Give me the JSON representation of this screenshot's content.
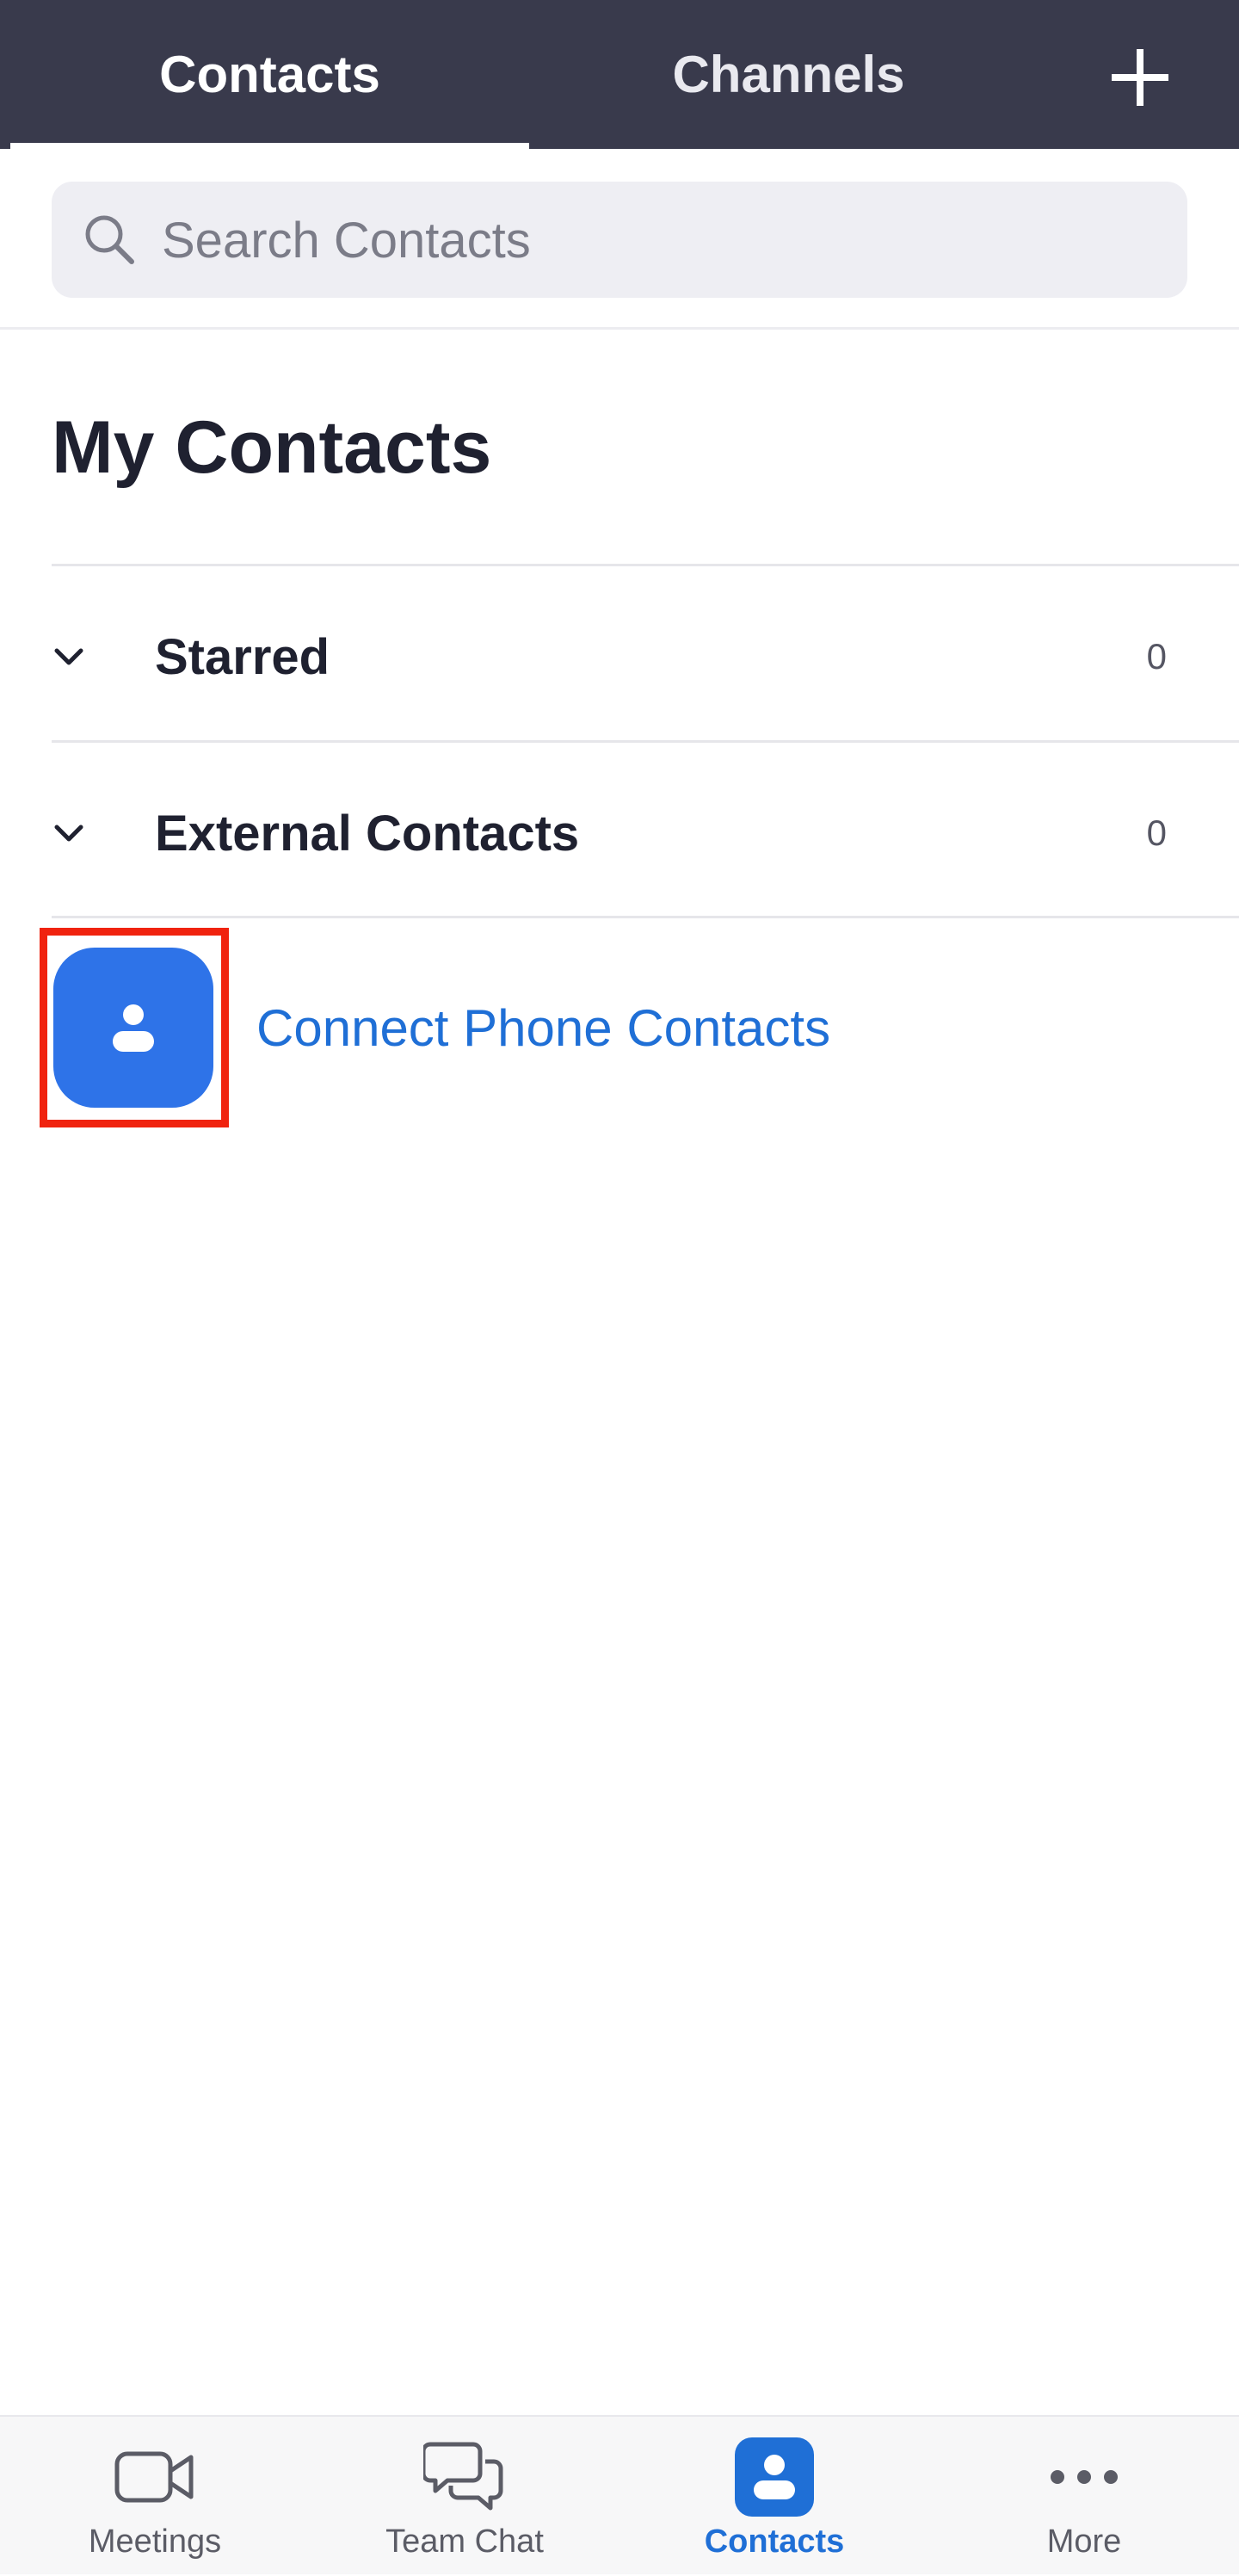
{
  "header": {
    "tabs": [
      {
        "label": "Contacts",
        "active": true
      },
      {
        "label": "Channels",
        "active": false
      }
    ],
    "add_icon": "plus-icon"
  },
  "search": {
    "placeholder": "Search Contacts",
    "value": ""
  },
  "main": {
    "title": "My Contacts",
    "groups": [
      {
        "label": "Starred",
        "count": "0"
      },
      {
        "label": "External Contacts",
        "count": "0"
      }
    ],
    "connect": {
      "label": "Connect Phone Contacts",
      "icon": "person-icon"
    }
  },
  "bottom_nav": {
    "items": [
      {
        "label": "Meetings",
        "icon": "video-camera-icon"
      },
      {
        "label": "Team Chat",
        "icon": "chat-bubbles-icon"
      },
      {
        "label": "Contacts",
        "icon": "contact-icon",
        "active": true
      },
      {
        "label": "More",
        "icon": "more-dots-icon"
      }
    ]
  },
  "colors": {
    "header_bg": "#393a4c",
    "accent": "#2e73e8",
    "link": "#1f6fd6",
    "highlight": "#f0230f"
  }
}
